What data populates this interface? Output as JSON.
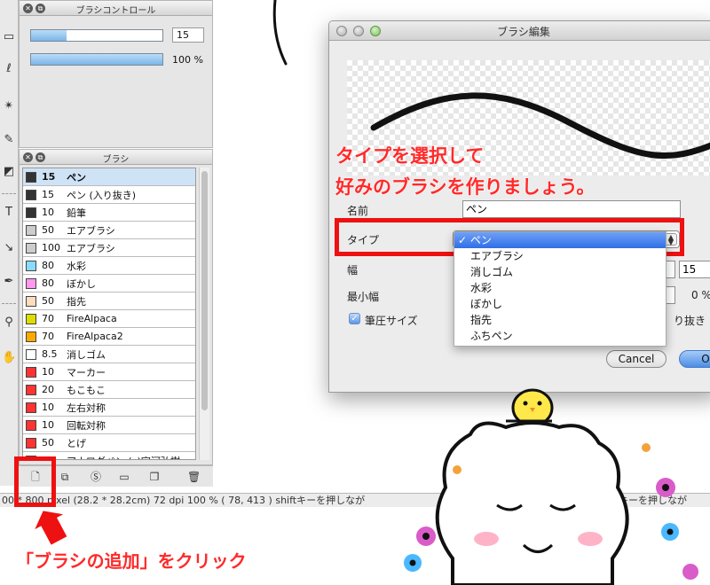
{
  "brush_control": {
    "title": "ブラシコントロール",
    "size_value": "15",
    "opacity_value": "100 %",
    "size_fraction": 0.27,
    "opacity_fraction": 1.0
  },
  "brush_panel": {
    "title": "ブラシ",
    "items": [
      {
        "size": "15",
        "name": "ペン",
        "color": "#333333",
        "selected": true
      },
      {
        "size": "15",
        "name": "ペン (入り抜き)",
        "color": "#333333"
      },
      {
        "size": "10",
        "name": "鉛筆",
        "color": "#333333"
      },
      {
        "size": "50",
        "name": "エアブラシ",
        "color": "#cccccc"
      },
      {
        "size": "100",
        "name": "エアブラシ",
        "color": "#cccccc"
      },
      {
        "size": "80",
        "name": "水彩",
        "color": "#88ddff"
      },
      {
        "size": "80",
        "name": "ぼかし",
        "color": "#ff99ee"
      },
      {
        "size": "50",
        "name": "指先",
        "color": "#ffddbb"
      },
      {
        "size": "70",
        "name": "FireAlpaca",
        "color": "#dddd00"
      },
      {
        "size": "70",
        "name": "FireAlpaca2",
        "color": "#ffaa00"
      },
      {
        "size": "8.5",
        "name": "消しゴム",
        "color": "#ffffff"
      },
      {
        "size": "10",
        "name": "マーカー",
        "color": "#ff3333"
      },
      {
        "size": "20",
        "name": "もこもこ",
        "color": "#ff3333"
      },
      {
        "size": "10",
        "name": "左右対称",
        "color": "#ff3333"
      },
      {
        "size": "10",
        "name": "回転対称",
        "color": "#ff3333"
      },
      {
        "size": "50",
        "name": "とげ",
        "color": "#ff3333"
      },
      {
        "size": "",
        "name": "アナログペン (c)宇河弘樹",
        "color": "#ff3333"
      }
    ]
  },
  "status_bar": {
    "text": "00 * 800 pixel  (28.2 * 28.2cm)  72 dpi  100 %  ( 78, 413 )  shiftキーを押しなが"
  },
  "status_bar_tail": "nキーを押しなが",
  "dialog": {
    "title": "ブラシ編集",
    "name_label": "名前",
    "name_value": "ペン",
    "type_label": "タイプ",
    "width_label": "幅",
    "width_value": "15",
    "min_width_label": "最小幅",
    "min_width_value": "0 %",
    "pressure_label": "筆圧サイズ",
    "pressure_checked": true,
    "fade_label": "り抜き",
    "type_options": [
      "ペン",
      "エアブラシ",
      "消しゴム",
      "水彩",
      "ぼかし",
      "指先",
      "ふちペン"
    ],
    "selected_type": "ペン",
    "cancel_label": "Cancel",
    "ok_label": "O"
  },
  "annotations": {
    "callout_line1": "タイプを選択して",
    "callout_line2": "好みのブラシを作りましょう。",
    "add_brush_caption": "「ブラシの追加」をクリック"
  },
  "colors": {
    "annotation_red": "#ee1111",
    "selection_blue": "#cfe3f6"
  }
}
